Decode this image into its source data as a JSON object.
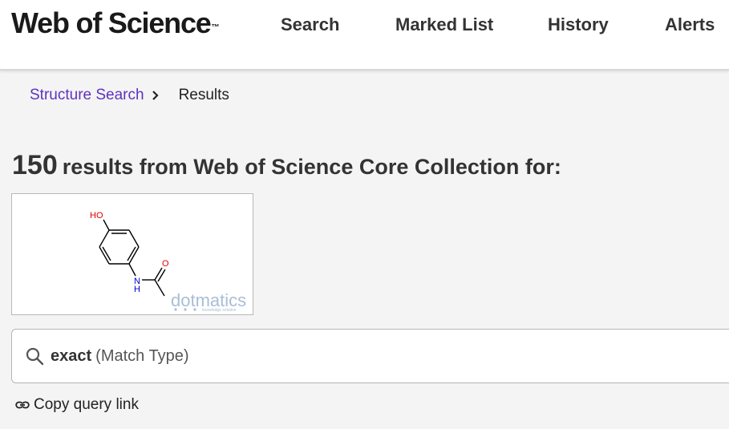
{
  "header": {
    "logo": "Web of Science",
    "logo_tm": "™",
    "nav": [
      "Search",
      "Marked List",
      "History",
      "Alerts"
    ]
  },
  "breadcrumb": {
    "link": "Structure Search",
    "current": "Results"
  },
  "results": {
    "count": "150",
    "text": "results from Web of Science Core Collection for:"
  },
  "structure": {
    "labels": {
      "hydroxyl": "HO",
      "oxygen": "O",
      "nitrogen": "N",
      "hydrogen": "H"
    },
    "watermark": "dotmatics",
    "watermark_tagline": "knowledge solution"
  },
  "query": {
    "value": "exact",
    "type": "(Match Type)"
  },
  "copy_link": {
    "label": "Copy query link"
  },
  "colors": {
    "link": "#5e33bf",
    "oxygen": "#e00000",
    "nitrogen": "#0000cc",
    "watermark": "#a9bed6"
  }
}
